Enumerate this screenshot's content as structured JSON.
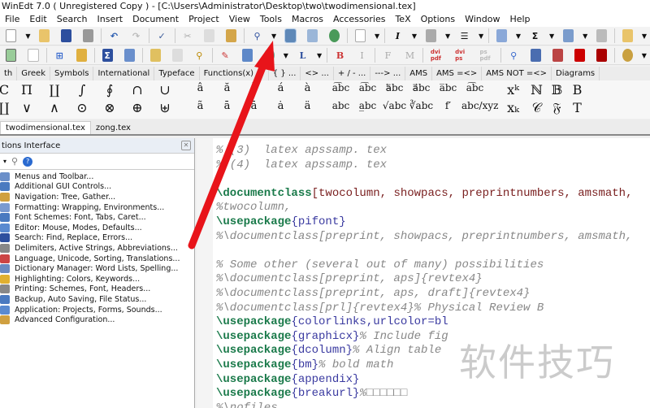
{
  "window": {
    "title": "WinEdt 7.0  ( Unregistered  Copy )  - [C:\\Users\\Administrator\\Desktop\\two\\twodimensional.tex]"
  },
  "menu": [
    "File",
    "Edit",
    "Search",
    "Insert",
    "Document",
    "Project",
    "View",
    "Tools",
    "Macros",
    "Accessories",
    "TeX",
    "Options",
    "Window",
    "Help"
  ],
  "toolbar2_labels": {
    "list": "L",
    "bold": "B",
    "italic": "I",
    "font": "F",
    "math": "M",
    "dvipdf": "dvi pdf",
    "dvips": "dvi ps",
    "pspdf": "ps pdf",
    "italic_btn": "I",
    "sigma": "Σ"
  },
  "symbol_tabs": [
    "th",
    "Greek",
    "Symbols",
    "International",
    "Typeface",
    "Functions(x) ...",
    "{ } ...",
    "<> ...",
    "+ / - ...",
    "---> ...",
    "AMS",
    "AMS =<>",
    "AMS NOT =<>",
    "Diagrams"
  ],
  "palette": {
    "row1": [
      "C",
      "Π",
      "∐",
      "∫",
      "∮",
      "∩",
      "∪",
      "â",
      "ă",
      "ǎ",
      "á",
      "à",
      "a͡bc",
      "a͡bc",
      "a⃖bc",
      "a⃗bc",
      "a̅bc",
      "a͡bc",
      "xᵏ",
      "ℕ",
      "𝔹",
      "B"
    ],
    "row2": [
      "∐",
      "∨",
      "∧",
      "⊙",
      "⊗",
      "⊕",
      "⊎",
      "ã",
      "ā",
      "ā",
      "ȧ",
      "ä",
      "abc",
      "a̲bc",
      "√abc",
      "∛abc",
      "f′",
      "abc/xyz",
      "xₖ",
      "𝒞",
      "𝔉",
      "T"
    ]
  },
  "file_tabs": [
    {
      "label": "twodimensional.tex",
      "active": true
    },
    {
      "label": "zong.tex",
      "active": false
    }
  ],
  "options_panel": {
    "title": "tions Interface",
    "items": [
      "Menus and Toolbar...",
      "Additional GUI Controls...",
      "Navigation: Tree, Gather...",
      "Formatting: Wrapping, Environments...",
      "Font Schemes: Font, Tabs, Caret...",
      "Editor: Mouse, Modes, Defaults...",
      "Search: Find, Replace, Errors...",
      "Delimiters, Active Strings, Abbreviations...",
      "Language, Unicode, Sorting, Translations...",
      "Dictionary Manager: Word Lists, Spelling...",
      "Highlighting: Colors, Keywords...",
      "Printing: Schemes, Font, Headers...",
      "Backup, Auto Saving, File Status...",
      "Application: Projects, Forms, Sounds...",
      "Advanced Configuration..."
    ]
  },
  "editor_lines": [
    [
      [
        "c",
        "% (3)  latex apssamp. tex"
      ]
    ],
    [
      [
        "c",
        "% (4)  latex apssamp. tex"
      ]
    ],
    [],
    [
      [
        "k",
        "\\documentclass"
      ],
      [
        "b",
        "[twocolumn, showpacs, preprintnumbers, amsmath, "
      ]
    ],
    [
      [
        "c",
        "%twocolumn,"
      ]
    ],
    [
      [
        "k",
        "\\usepackage"
      ],
      [
        "a",
        "{pifont}"
      ]
    ],
    [
      [
        "c",
        "%\\documentclass[preprint, showpacs, preprintnumbers, amsmath, "
      ]
    ],
    [],
    [
      [
        "c",
        "% Some other (several out of many) possibilities"
      ]
    ],
    [
      [
        "c",
        "%\\documentclass[preprint, aps]{revtex4}"
      ]
    ],
    [
      [
        "c",
        "%\\documentclass[preprint, aps, draft]{revtex4}"
      ]
    ],
    [
      [
        "c",
        "%\\documentclass[prl]{revtex4}% Physical Review B"
      ]
    ],
    [
      [
        "k",
        "\\usepackage"
      ],
      [
        "a",
        "{colorlinks,urlcolor=bl"
      ]
    ],
    [
      [
        "k",
        "\\usepackage"
      ],
      [
        "a",
        "{graphicx}"
      ],
      [
        "c",
        "% Include fig"
      ]
    ],
    [
      [
        "k",
        "\\usepackage"
      ],
      [
        "a",
        "{dcolumn}"
      ],
      [
        "c",
        "% Align table"
      ]
    ],
    [
      [
        "k",
        "\\usepackage"
      ],
      [
        "a",
        "{bm}"
      ],
      [
        "c",
        "% bold math"
      ]
    ],
    [
      [
        "k",
        "\\usepackage"
      ],
      [
        "a",
        "{appendix}"
      ]
    ],
    [
      [
        "k",
        "\\usepackage"
      ],
      [
        "a",
        "{breakurl}"
      ],
      [
        "c",
        "%□□□□□□"
      ]
    ],
    [
      [
        "c",
        "%\\nofiles"
      ]
    ]
  ],
  "watermark": "软件技巧",
  "colors": {
    "arrow": "#e8141a",
    "keyword": "#1a7a4a",
    "comment": "#888888",
    "argument": "#3a3aa0"
  }
}
